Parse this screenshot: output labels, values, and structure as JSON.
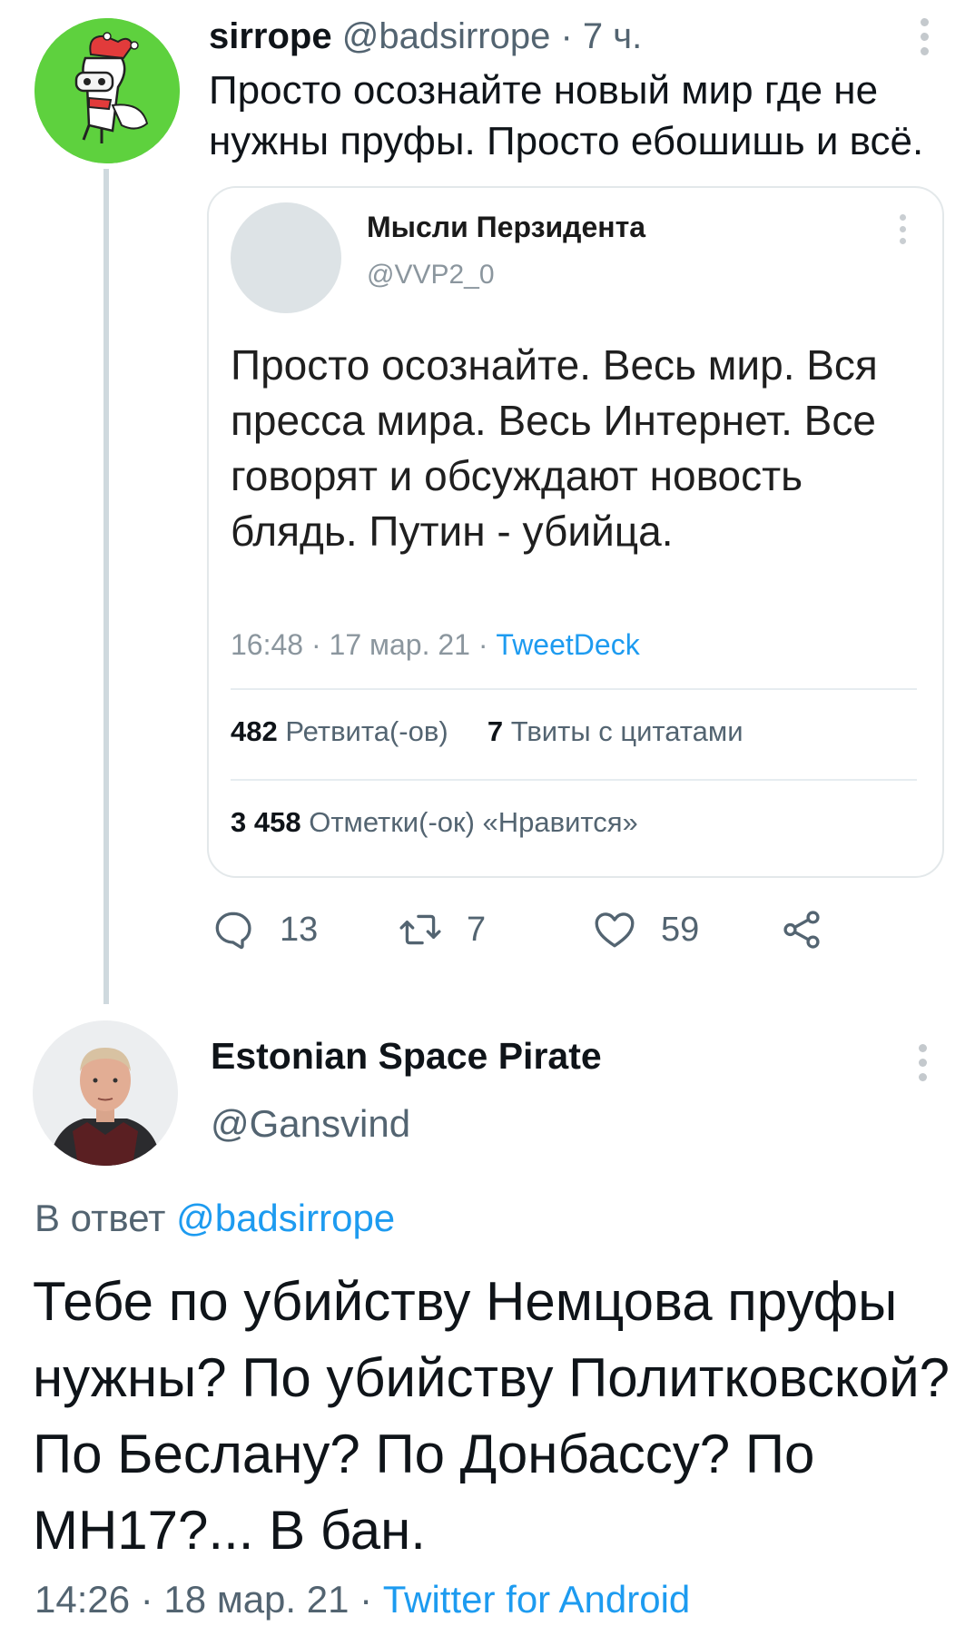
{
  "tweet": {
    "author_name": "sirrope",
    "author_handle": "@badsirrope",
    "separator": "·",
    "time_ago": "7 ч.",
    "text": "Просто осознайте новый мир где не нужны пруфы. Просто ебошишь и всё.",
    "quoted": {
      "author_name": "Мысли Перзидента",
      "author_handle": "@VVP2_0",
      "text": "Просто осознайте. Весь мир. Вся пресса мира. Весь Интернет. Все говорят и обсуждают новость блядь. Путин - убийца.",
      "timestamp": "16:48 · 17 мар. 21 · ",
      "source": "TweetDeck",
      "retweets_count": "482",
      "retweets_label": "Ретвита(-ов)",
      "quotes_count": "7",
      "quotes_label": "Твиты с цитатами",
      "likes_count": "3 458",
      "likes_label": "Отметки(-ок) «Нравится»"
    },
    "actions": {
      "replies": "13",
      "retweets": "7",
      "likes": "59"
    }
  },
  "reply": {
    "author_name": "Estonian Space Pirate",
    "author_handle": "@Gansvind",
    "reply_prefix": "В ответ ",
    "reply_mention": "@badsirrope",
    "text": "Тебе по убийству Немцова пруфы нужны? По убийству Политковской? По Беслану? По Донбассу? По МН17?... В бан.",
    "timestamp": "14:26 · 18 мар. 21 · ",
    "source": "Twitter for Android"
  },
  "icons": {
    "more": "more-vertical-icon",
    "reply": "reply-bubble-icon",
    "retweet": "retweet-icon",
    "like": "heart-icon",
    "share": "share-icon"
  },
  "colors": {
    "accent": "#1d9bf0",
    "secondary_text": "#536471",
    "avatar_green": "#5ed13e"
  }
}
